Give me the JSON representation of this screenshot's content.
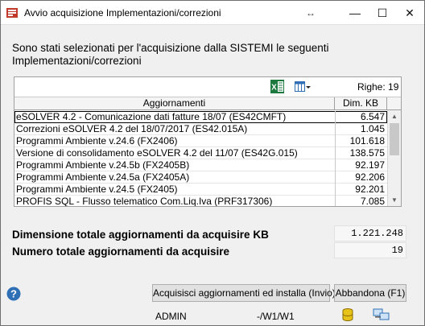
{
  "window": {
    "title": "Avvio acquisizione Implementazioni/correzioni",
    "resize_glyph": "↔",
    "minimize": "—",
    "maximize": "☐",
    "close": "✕"
  },
  "intro": {
    "text": "Sono stati selezionati per l'acquisizione dalla SISTEMI le seguenti Implementazioni/correzioni"
  },
  "grid": {
    "excel_icon": "excel-icon",
    "columns_icon": "columns-config-icon",
    "righe_label": "Righe: 19",
    "col_name_header": "Aggiornamenti",
    "col_size_header": "Dim. KB",
    "rows": [
      {
        "name": "eSOLVER 4.2 - Comunicazione dati fatture 18/07 (ES42CMFT)",
        "size": "6.547"
      },
      {
        "name": "Correzioni eSOLVER 4.2 del 18/07/2017 (ES42.015A)",
        "size": "1.045"
      },
      {
        "name": "Programmi Ambiente v.24.6 (FX2406)",
        "size": "101.618"
      },
      {
        "name": "Versione di consolidamento eSOLVER 4.2 del 11/07 (ES42G.015)",
        "size": "138.575"
      },
      {
        "name": "Programmi Ambiente v.24.5b (FX2405B)",
        "size": "92.197"
      },
      {
        "name": "Programmi Ambiente v.24.5a (FX2405A)",
        "size": "92.206"
      },
      {
        "name": "Programmi Ambiente v.24.5 (FX2405)",
        "size": "92.201"
      },
      {
        "name": "PROFIS SQL - Flusso telematico Com.Liq.Iva (PRF317306)",
        "size": "7.085"
      }
    ],
    "selected_row": 0
  },
  "summary": {
    "total_size_label": "Dimensione totale aggiornamenti da acquisire KB",
    "total_size_value": "1.221.248",
    "total_count_label": "Numero totale aggiornamenti da acquisire",
    "total_count_value": "19"
  },
  "buttons": {
    "install": "Acquisisci aggiornamenti ed installa (Invio)",
    "abort": "Abbandona (F1)"
  },
  "statusbar": {
    "user": "ADMIN",
    "path": "-/W1/W1"
  },
  "colors": {
    "accent": "#2f6fb5",
    "excel_green": "#1d7a3e",
    "db_yellow": "#e6c21a"
  }
}
